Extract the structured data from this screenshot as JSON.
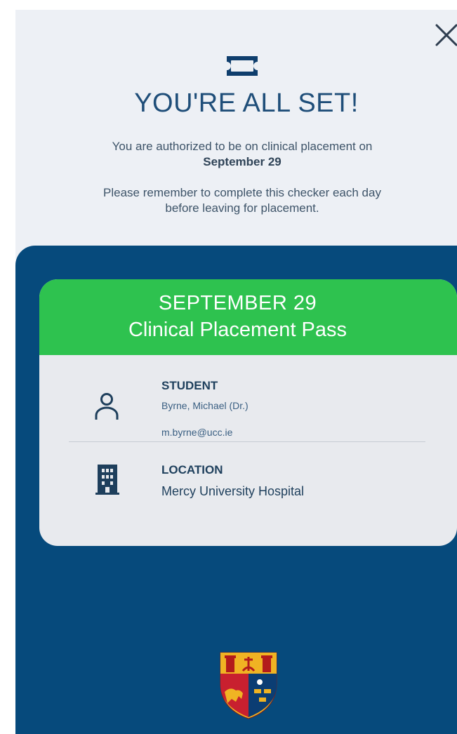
{
  "header": {
    "close_icon": "close-icon",
    "ticket_icon": "ticket-icon",
    "title": "YOU'RE ALL SET!",
    "auth_prefix": "You are authorized to be on clinical placement on",
    "auth_date": "September 29",
    "reminder": "Please remember to complete this checker each day before leaving for placement."
  },
  "pass": {
    "date": "SEPTEMBER 29",
    "name": "Clinical Placement Pass",
    "header_color": "#2ec24f",
    "student": {
      "icon": "person-icon",
      "label": "STUDENT",
      "name": "Byrne, Michael (Dr.)",
      "email": "m.byrne@ucc.ie"
    },
    "location": {
      "icon": "building-icon",
      "label": "LOCATION",
      "value": "Mercy University Hospital"
    }
  },
  "footer": {
    "crest_icon": "university-crest-icon"
  },
  "colors": {
    "top_background": "#edf0f5",
    "panel_blue": "#064a7c",
    "pass_green": "#2ec24f",
    "card_background": "#e8eaee",
    "title_text": "#1f4e79"
  }
}
